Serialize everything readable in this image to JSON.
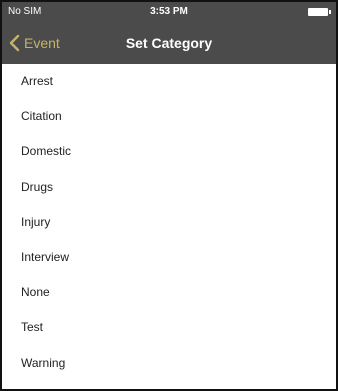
{
  "status_bar": {
    "carrier": "No SIM",
    "time": "3:53 PM"
  },
  "nav": {
    "back_label": "Event",
    "title": "Set Category"
  },
  "categories": [
    "Arrest",
    "Citation",
    "Domestic",
    "Drugs",
    "Injury",
    "Interview",
    "None",
    "Test",
    "Warning"
  ],
  "colors": {
    "bar_background": "#4b4b4b",
    "back_accent": "#c6b36a"
  }
}
